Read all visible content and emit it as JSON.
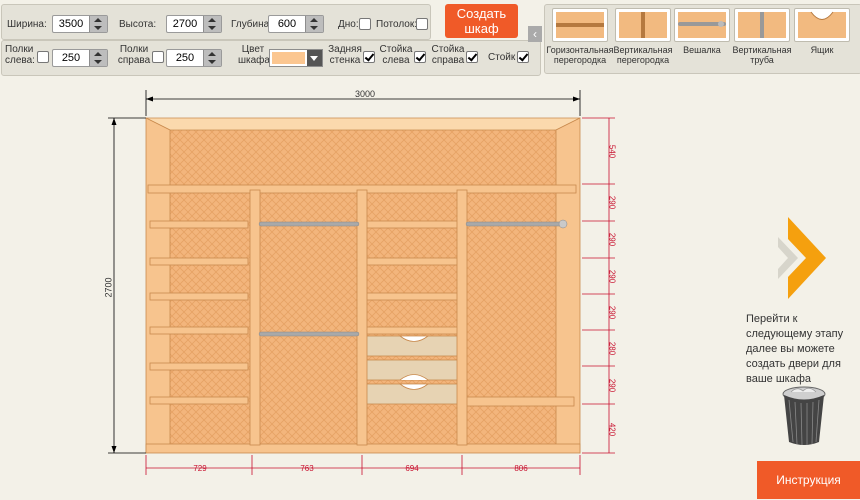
{
  "params": {
    "width_label": "Ширина:",
    "width_value": "3500",
    "height_label": "Высота:",
    "height_value": "2700",
    "depth_label": "Глубина:",
    "depth_value": "600",
    "bottom_label": "Дно:",
    "ceiling_label": "Потолок:",
    "shelves_left_label": "Полки слева:",
    "shelves_left_value": "250",
    "shelves_right_label": "Полки справа",
    "shelves_right_value": "250",
    "color_label": "Цвет шкафа:",
    "back_wall_label": "Задняя стенка",
    "post_left_label": "Стойка слева",
    "post_right_label": "Стойка справа",
    "posts_label": "Стойк"
  },
  "create_button": "Создать шкаф",
  "collapse_icon": "chevron-left-icon",
  "tools": [
    {
      "label": "Горизонтальная перегородка",
      "icon": "horizontal-divider-icon"
    },
    {
      "label": "Вертикальная перегородка",
      "icon": "vertical-divider-icon"
    },
    {
      "label": "Вешалка",
      "icon": "hanger-rail-icon"
    },
    {
      "label": "Вертикальная труба",
      "icon": "vertical-pipe-icon"
    },
    {
      "label": "Ящик",
      "icon": "drawer-icon"
    }
  ],
  "dimensions": {
    "total_width": "3000",
    "total_height": "2700",
    "columns": [
      "729",
      "763",
      "694",
      "806"
    ],
    "rows": [
      "540",
      "290",
      "290",
      "290",
      "290",
      "280",
      "290",
      "420"
    ]
  },
  "next_step_text": "Перейти к следующему этапу далее вы можете создать двери для ваше шкафа",
  "next_icon": "chevron-right-icon",
  "trash_icon": "trash-bin-icon",
  "instruction_button": "Инструкция",
  "colors": {
    "wood": "#f7c48e",
    "wood_edge": "#c98a4e",
    "back": "#f3b57c",
    "dim_red": "#c8102e",
    "accent": "#f05a28",
    "arrow": "#f5a00e"
  }
}
